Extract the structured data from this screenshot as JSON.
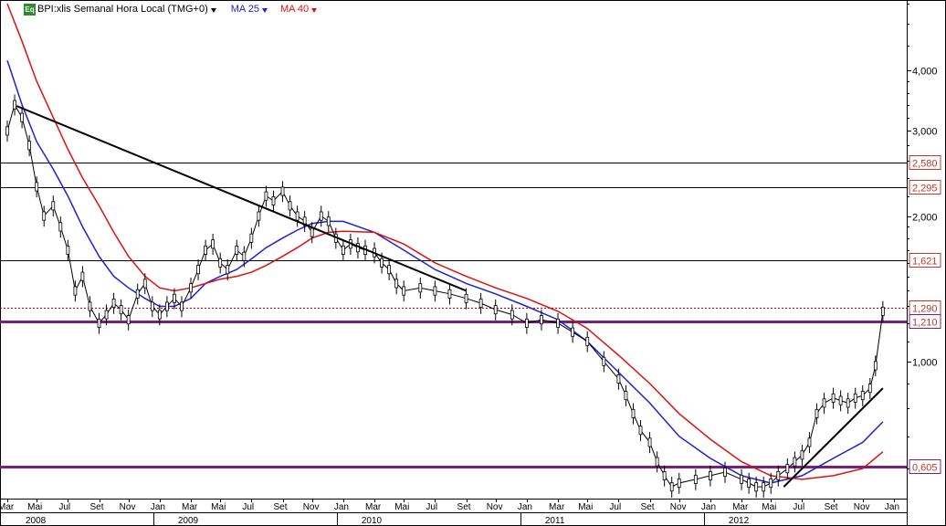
{
  "header": {
    "badge": "Eq",
    "title": "BPI:xlis Semanal Hora Local (TMG+0)",
    "ma_fast": "MA 25",
    "ma_slow": "MA 40"
  },
  "colors": {
    "price": "#000000",
    "ma_fast": "#1f1fd6",
    "ma_slow": "#e01010",
    "trend": "#000000",
    "level": "#000000",
    "purple": "#7a1f7a",
    "red_level": "#cc0000",
    "tag": "#c0392b"
  },
  "chart_data": {
    "type": "line",
    "title": "BPI:xlis Semanal Hora Local (TMG+0)",
    "y_scale": "log",
    "ylim": [
      0.52,
      5.6
    ],
    "y_ticks": [
      {
        "value": 4.0,
        "label": "4,000"
      },
      {
        "value": 3.0,
        "label": "3,000"
      },
      {
        "value": 2.0,
        "label": "2,000"
      },
      {
        "value": 1.0,
        "label": "1,000"
      }
    ],
    "x_range": [
      2008.17,
      2013.07
    ],
    "months": [
      {
        "x": 2008.17,
        "label": "Mar"
      },
      {
        "x": 2008.33,
        "label": "Mai"
      },
      {
        "x": 2008.5,
        "label": "Jul"
      },
      {
        "x": 2008.67,
        "label": "Set"
      },
      {
        "x": 2008.83,
        "label": "Nov"
      },
      {
        "x": 2009.0,
        "label": "Jan"
      },
      {
        "x": 2009.17,
        "label": "Mar"
      },
      {
        "x": 2009.33,
        "label": "Mai"
      },
      {
        "x": 2009.5,
        "label": "Jul"
      },
      {
        "x": 2009.67,
        "label": "Set"
      },
      {
        "x": 2009.83,
        "label": "Nov"
      },
      {
        "x": 2010.0,
        "label": "Jan"
      },
      {
        "x": 2010.17,
        "label": "Mar"
      },
      {
        "x": 2010.33,
        "label": "Mai"
      },
      {
        "x": 2010.5,
        "label": "Jul"
      },
      {
        "x": 2010.67,
        "label": "Set"
      },
      {
        "x": 2010.83,
        "label": "Nov"
      },
      {
        "x": 2011.0,
        "label": "Jan"
      },
      {
        "x": 2011.17,
        "label": "Mar"
      },
      {
        "x": 2011.33,
        "label": "Mai"
      },
      {
        "x": 2011.5,
        "label": "Jul"
      },
      {
        "x": 2011.67,
        "label": "Set"
      },
      {
        "x": 2011.83,
        "label": "Nov"
      },
      {
        "x": 2012.0,
        "label": "Jan"
      },
      {
        "x": 2012.17,
        "label": "Mar"
      },
      {
        "x": 2012.33,
        "label": "Mai"
      },
      {
        "x": 2012.5,
        "label": "Jul"
      },
      {
        "x": 2012.67,
        "label": "Set"
      },
      {
        "x": 2012.83,
        "label": "Nov"
      },
      {
        "x": 2013.0,
        "label": "Jan"
      }
    ],
    "years": [
      {
        "x": 2008.17,
        "label": "2008"
      },
      {
        "x": 2009.0,
        "label": "2009"
      },
      {
        "x": 2010.0,
        "label": "2010"
      },
      {
        "x": 2011.0,
        "label": "2011"
      },
      {
        "x": 2012.0,
        "label": "2012"
      }
    ],
    "levels": [
      {
        "value": 2.58,
        "label": "2,580",
        "style": "black"
      },
      {
        "value": 2.295,
        "label": "2,295",
        "style": "black"
      },
      {
        "value": 1.621,
        "label": "1,621",
        "style": "black"
      },
      {
        "value": 1.29,
        "label": "1,290",
        "style": "red_dotted"
      },
      {
        "value": 1.21,
        "label": "1,210",
        "style": "purple"
      },
      {
        "value": 0.605,
        "label": "0,605",
        "style": "purple"
      }
    ],
    "price": {
      "x": [
        2008.17,
        2008.21,
        2008.25,
        2008.29,
        2008.33,
        2008.37,
        2008.42,
        2008.46,
        2008.5,
        2008.54,
        2008.58,
        2008.62,
        2008.67,
        2008.71,
        2008.75,
        2008.79,
        2008.83,
        2008.88,
        2008.92,
        2008.96,
        2009.0,
        2009.04,
        2009.08,
        2009.12,
        2009.17,
        2009.21,
        2009.25,
        2009.29,
        2009.33,
        2009.37,
        2009.42,
        2009.46,
        2009.5,
        2009.54,
        2009.58,
        2009.62,
        2009.67,
        2009.71,
        2009.75,
        2009.79,
        2009.83,
        2009.88,
        2009.92,
        2009.96,
        2010.0,
        2010.04,
        2010.08,
        2010.12,
        2010.17,
        2010.21,
        2010.25,
        2010.29,
        2010.33,
        2010.42,
        2010.5,
        2010.58,
        2010.67,
        2010.75,
        2010.83,
        2010.92,
        2011.0,
        2011.08,
        2011.17,
        2011.25,
        2011.33,
        2011.42,
        2011.5,
        2011.54,
        2011.58,
        2011.62,
        2011.67,
        2011.71,
        2011.75,
        2011.79,
        2011.83,
        2011.92,
        2012.0,
        2012.08,
        2012.17,
        2012.21,
        2012.25,
        2012.29,
        2012.33,
        2012.37,
        2012.42,
        2012.46,
        2012.5,
        2012.54,
        2012.58,
        2012.62,
        2012.67,
        2012.71,
        2012.75,
        2012.79,
        2012.83,
        2012.87,
        2012.9,
        2012.94
      ],
      "values": [
        3.0,
        3.4,
        3.2,
        2.8,
        2.3,
        2.0,
        2.1,
        1.9,
        1.7,
        1.4,
        1.5,
        1.3,
        1.2,
        1.25,
        1.32,
        1.28,
        1.22,
        1.38,
        1.45,
        1.3,
        1.25,
        1.3,
        1.35,
        1.3,
        1.42,
        1.55,
        1.7,
        1.75,
        1.6,
        1.55,
        1.7,
        1.65,
        1.8,
        2.0,
        2.2,
        2.15,
        2.25,
        2.1,
        2.0,
        1.95,
        1.85,
        2.0,
        1.95,
        1.8,
        1.7,
        1.75,
        1.72,
        1.7,
        1.68,
        1.6,
        1.55,
        1.45,
        1.4,
        1.42,
        1.4,
        1.38,
        1.35,
        1.32,
        1.28,
        1.25,
        1.2,
        1.22,
        1.2,
        1.15,
        1.1,
        1.0,
        0.92,
        0.85,
        0.78,
        0.72,
        0.68,
        0.62,
        0.58,
        0.55,
        0.56,
        0.57,
        0.58,
        0.59,
        0.57,
        0.56,
        0.55,
        0.55,
        0.56,
        0.58,
        0.6,
        0.62,
        0.64,
        0.68,
        0.78,
        0.82,
        0.84,
        0.83,
        0.82,
        0.84,
        0.85,
        0.88,
        0.98,
        1.27
      ]
    },
    "series": [
      {
        "name": "MA 25",
        "x": [
          2008.17,
          2008.25,
          2008.33,
          2008.42,
          2008.5,
          2008.58,
          2008.67,
          2008.75,
          2008.83,
          2008.92,
          2009.0,
          2009.08,
          2009.17,
          2009.25,
          2009.33,
          2009.42,
          2009.5,
          2009.58,
          2009.67,
          2009.75,
          2009.83,
          2009.92,
          2010.0,
          2010.17,
          2010.33,
          2010.5,
          2010.67,
          2010.83,
          2011.0,
          2011.17,
          2011.33,
          2011.5,
          2011.67,
          2011.83,
          2012.0,
          2012.17,
          2012.33,
          2012.5,
          2012.67,
          2012.83,
          2012.94
        ],
        "values": [
          4.2,
          3.4,
          2.85,
          2.5,
          2.2,
          1.9,
          1.65,
          1.5,
          1.42,
          1.35,
          1.3,
          1.3,
          1.35,
          1.45,
          1.5,
          1.55,
          1.63,
          1.72,
          1.8,
          1.87,
          1.93,
          1.95,
          1.95,
          1.85,
          1.7,
          1.55,
          1.45,
          1.38,
          1.3,
          1.22,
          1.1,
          0.95,
          0.82,
          0.7,
          0.63,
          0.58,
          0.56,
          0.58,
          0.63,
          0.68,
          0.75
        ]
      },
      {
        "name": "MA 40",
        "x": [
          2008.17,
          2008.25,
          2008.33,
          2008.42,
          2008.5,
          2008.58,
          2008.67,
          2008.75,
          2008.83,
          2008.92,
          2009.0,
          2009.08,
          2009.17,
          2009.25,
          2009.33,
          2009.42,
          2009.5,
          2009.58,
          2009.67,
          2009.75,
          2009.83,
          2009.92,
          2010.0,
          2010.17,
          2010.33,
          2010.5,
          2010.67,
          2010.83,
          2011.0,
          2011.17,
          2011.33,
          2011.5,
          2011.67,
          2011.83,
          2012.0,
          2012.17,
          2012.33,
          2012.5,
          2012.67,
          2012.83,
          2012.94
        ],
        "values": [
          5.5,
          4.6,
          3.8,
          3.2,
          2.75,
          2.4,
          2.1,
          1.85,
          1.65,
          1.5,
          1.42,
          1.4,
          1.42,
          1.45,
          1.48,
          1.5,
          1.53,
          1.58,
          1.65,
          1.72,
          1.8,
          1.85,
          1.86,
          1.85,
          1.75,
          1.6,
          1.5,
          1.42,
          1.35,
          1.27,
          1.17,
          1.03,
          0.9,
          0.78,
          0.69,
          0.62,
          0.58,
          0.57,
          0.58,
          0.6,
          0.65
        ]
      }
    ],
    "trendlines": [
      {
        "x": [
          2008.22,
          2010.67
        ],
        "values": [
          3.38,
          1.4
        ]
      },
      {
        "x": [
          2012.4,
          2012.94
        ],
        "values": [
          0.55,
          0.88
        ]
      }
    ],
    "grid": false
  }
}
